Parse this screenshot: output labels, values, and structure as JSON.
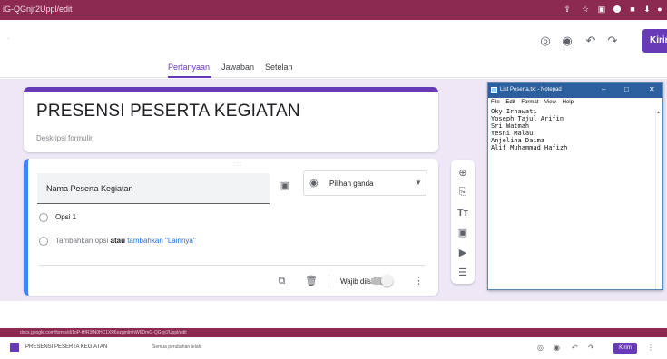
{
  "browser": {
    "url": "iG-QGnjr2Uppl/edit",
    "toolbar_icons": [
      "share-icon",
      "star-icon",
      "extension-icon",
      "record-icon",
      "extension-icon",
      "download-icon",
      "account-icon",
      "close-icon"
    ]
  },
  "header": {
    "icons": [
      "palette-icon",
      "preview-icon",
      "undo-icon",
      "redo-icon"
    ],
    "send_label": "Kirim"
  },
  "tabs": [
    {
      "label": "Pertanyaan",
      "active": true
    },
    {
      "label": "Jawaban",
      "active": false
    },
    {
      "label": "Setelan",
      "active": false
    }
  ],
  "form": {
    "title": "PRESENSI PESERTA KEGIATAN",
    "description_placeholder": "Deskripsi formulir"
  },
  "question": {
    "drag_handle": ":::",
    "title": "Nama Peserta Kegiatan",
    "type_label": "Pilihan ganda",
    "option1": "Opsi 1",
    "add_option_text": "Tambahkan opsi",
    "or_text": "atau",
    "add_other_text": "tambahkan \"Lainnya\"",
    "required_label": "Wajib diisi"
  },
  "sidebar_icons": [
    "add-question-icon",
    "import-questions-icon",
    "title-icon",
    "image-icon",
    "video-icon",
    "section-icon"
  ],
  "notepad": {
    "title": "List Peserta.txt - Notepad",
    "menu": [
      "File",
      "Edit",
      "Format",
      "View",
      "Help"
    ],
    "lines": [
      "Oky Irnawati",
      "Yoseph Tajul Arifin",
      "Sri Watmah",
      "Yesni Malau",
      "Anjelina Daima",
      "Alif Muhammad Hafizh"
    ]
  },
  "second_screenshot": {
    "url": "docs.google.com/forms/d/1oP-HfR3fN0HC1XR6ozgmlmhW6DmG-QGnjr2Uppl/edit",
    "doc_title": "PRESENSI PESERTA KEGIATAN",
    "saved_text": "Semua perubahan telah",
    "send_label": "Kirim"
  },
  "colors": {
    "accent": "#673ab7",
    "browser_bar": "#8c2a52",
    "background": "#ede7f6",
    "active_card": "#4285f4"
  }
}
